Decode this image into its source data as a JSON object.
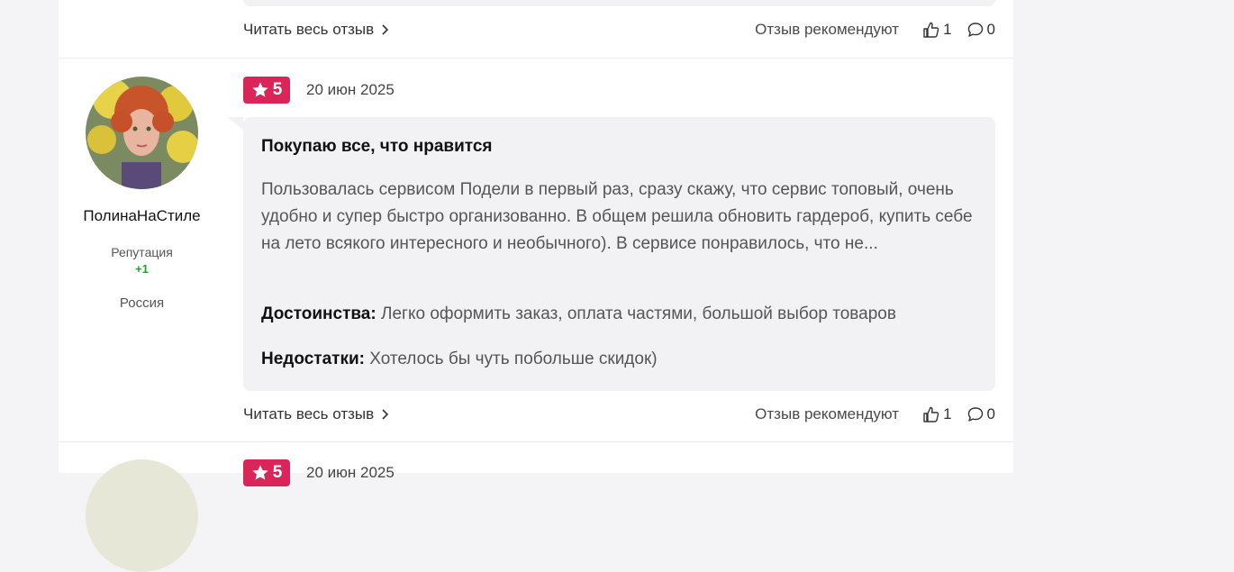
{
  "previous_review": {
    "read_more": "Читать весь отзыв",
    "recommend_label": "Отзыв рекомендуют",
    "likes": "1",
    "comments": "0"
  },
  "review": {
    "rating": "5",
    "date": "20 июн 2025",
    "author": {
      "name": "ПолинаНаСтиле",
      "reputation_label": "Репутация",
      "reputation_value": "+1",
      "country": "Россия"
    },
    "title": "Покупаю все, что нравится",
    "text": "Пользовалась сервисом Подели в первый раз, сразу скажу, что сервис топовый, очень удобно и супер быстро организованно. В общем решила обновить гардероб, купить себе на лето всякого интересного и необычного). В сервисе понравилось, что не...",
    "pros_label": "Достоинства:",
    "pros": "Легко оформить заказ, оплата частями, большой выбор товаров",
    "cons_label": "Недостатки:",
    "cons": "Хотелось бы чуть побольше скидок)",
    "read_more": "Читать весь отзыв",
    "recommend_label": "Отзыв рекомендуют",
    "likes": "1",
    "comments": "0"
  },
  "next_review": {
    "rating": "5",
    "date": "20 июн 2025"
  },
  "colors": {
    "rating_badge": "#d9255a",
    "reputation_positive": "#2aa22a",
    "review_box": "#f2f2f5"
  }
}
